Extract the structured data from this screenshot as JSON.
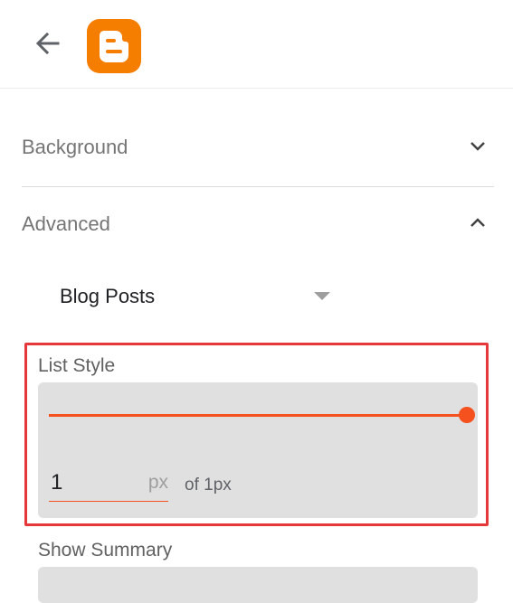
{
  "header": {
    "back_icon": "arrow-left-icon",
    "logo": "blogger-logo"
  },
  "sections": {
    "background": {
      "label": "Background",
      "icon": "chevron-down-icon"
    },
    "advanced": {
      "label": "Advanced",
      "icon": "chevron-up-icon"
    }
  },
  "dropdown": {
    "selected": "Blog Posts"
  },
  "list_style": {
    "title": "List Style",
    "value": "1",
    "unit": "px",
    "max_text": "of 1px",
    "slider_fraction": 1.0
  },
  "show_summary": {
    "title": "Show Summary"
  },
  "colors": {
    "accent": "#f4511e",
    "logo": "#f57d00",
    "highlight": "#e5383b",
    "panel": "#e0e0e0"
  }
}
